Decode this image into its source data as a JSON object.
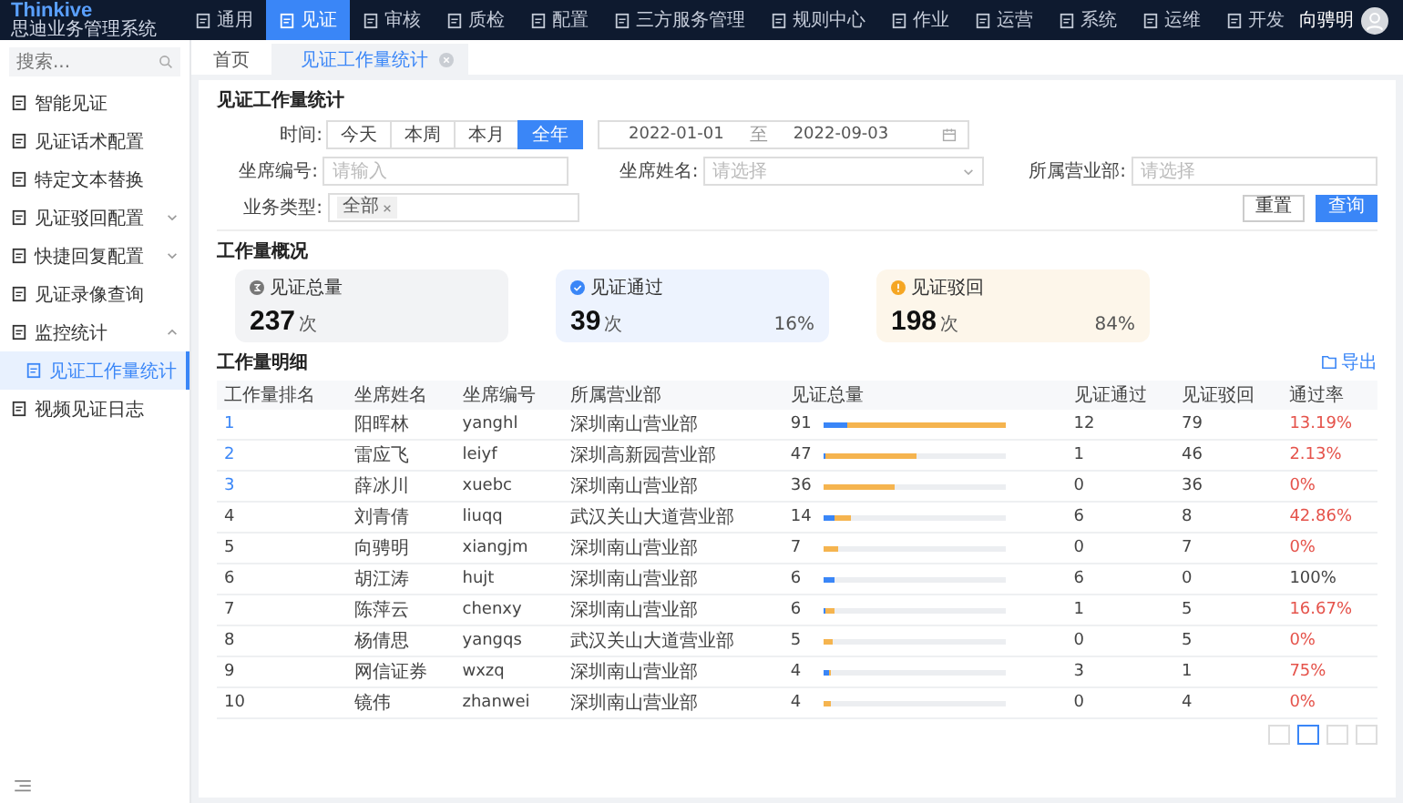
{
  "logo": {
    "name": "Thinkive",
    "subtitle": "思迪业务管理系统"
  },
  "nav": [
    {
      "label": "通用",
      "selected": false
    },
    {
      "label": "见证",
      "selected": true
    },
    {
      "label": "审核",
      "selected": false
    },
    {
      "label": "质检",
      "selected": false
    },
    {
      "label": "配置",
      "selected": false
    },
    {
      "label": "三方服务管理",
      "selected": false
    },
    {
      "label": "规则中心",
      "selected": false
    },
    {
      "label": "作业",
      "selected": false
    },
    {
      "label": "运营",
      "selected": false
    },
    {
      "label": "系统",
      "selected": false
    },
    {
      "label": "运维",
      "selected": false
    },
    {
      "label": "开发",
      "selected": false
    }
  ],
  "user": {
    "name": "向骋明"
  },
  "sidebar": {
    "search_placeholder": "搜索...",
    "items": [
      {
        "label": "智能见证",
        "selected": false
      },
      {
        "label": "见证话术配置",
        "selected": false
      },
      {
        "label": "特定文本替换",
        "selected": false
      },
      {
        "label": "见证驳回配置",
        "selected": false,
        "expanded": false
      },
      {
        "label": "快捷回复配置",
        "selected": false,
        "expanded": false
      },
      {
        "label": "见证录像查询",
        "selected": false
      },
      {
        "label": "监控统计",
        "selected": false,
        "expanded": true,
        "children": [
          {
            "label": "见证工作量统计",
            "selected": true
          }
        ]
      },
      {
        "label": "视频见证日志",
        "selected": false
      }
    ]
  },
  "tabs": [
    {
      "label": "首页",
      "selected": false,
      "closable": false
    },
    {
      "label": "见证工作量统计",
      "selected": true,
      "closable": true
    }
  ],
  "page_title": "见证工作量统计",
  "filters": {
    "time_label": "时间:",
    "periods": [
      {
        "label": "今天",
        "selected": false
      },
      {
        "label": "本周",
        "selected": false
      },
      {
        "label": "本月",
        "selected": false
      },
      {
        "label": "全年",
        "selected": true
      }
    ],
    "date_from": "2022-01-01",
    "date_sep": "至",
    "date_to": "2022-09-03",
    "seat_code": {
      "label": "坐席编号:",
      "placeholder": "请输入"
    },
    "seat_name": {
      "label": "坐席姓名:",
      "placeholder": "请选择"
    },
    "branch": {
      "label": "所属营业部:",
      "placeholder": "请选择"
    },
    "business": {
      "label": "业务类型:",
      "tags": [
        "全部"
      ]
    },
    "reset": "重置",
    "query": "查询"
  },
  "overview": {
    "title": "工作量概况",
    "cards": [
      {
        "kind": "total",
        "label": "见证总量",
        "value": "237",
        "unit": "次"
      },
      {
        "kind": "pass",
        "label": "见证通过",
        "value": "39",
        "unit": "次",
        "percent": "16%"
      },
      {
        "kind": "reject",
        "label": "见证驳回",
        "value": "198",
        "unit": "次",
        "percent": "84%"
      }
    ]
  },
  "detail": {
    "title": "工作量明细",
    "export": "导出",
    "columns": [
      "工作量排名",
      "坐席姓名",
      "坐席编号",
      "所属营业部",
      "见证总量",
      "见证通过",
      "见证驳回",
      "通过率"
    ],
    "rows": [
      {
        "rank": "1",
        "top": true,
        "name": "阳晖林",
        "code": "yanghl",
        "dept": "深圳南山营业部",
        "total": "91",
        "pass": "12",
        "reject": "79",
        "rate": "13.19%",
        "low": true,
        "pass_bar": {
          "level": 0.132
        },
        "reject_bar": {
          "level": 0.868
        }
      },
      {
        "rank": "2",
        "top": true,
        "name": "雷应飞",
        "code": "leiyf",
        "dept": "深圳高新园营业部",
        "total": "47",
        "pass": "1",
        "reject": "46",
        "rate": "2.13%",
        "low": true,
        "pass_bar": {
          "level": 0.011
        },
        "reject_bar": {
          "level": 0.505
        }
      },
      {
        "rank": "3",
        "top": true,
        "name": "薛冰川",
        "code": "xuebc",
        "dept": "深圳南山营业部",
        "total": "36",
        "pass": "0",
        "reject": "36",
        "rate": "0%",
        "low": true,
        "reject_bar": {
          "level": 0.396
        }
      },
      {
        "rank": "4",
        "top": false,
        "name": "刘青倩",
        "code": "liuqq",
        "dept": "武汉关山大道营业部",
        "total": "14",
        "pass": "6",
        "reject": "8",
        "rate": "42.86%",
        "low": true,
        "pass_bar": {
          "level": 0.066
        },
        "reject_bar": {
          "level": 0.088
        }
      },
      {
        "rank": "5",
        "top": false,
        "name": "向骋明",
        "code": "xiangjm",
        "dept": "深圳南山营业部",
        "total": "7",
        "pass": "0",
        "reject": "7",
        "rate": "0%",
        "low": true,
        "reject_bar": {
          "level": 0.077
        }
      },
      {
        "rank": "6",
        "top": false,
        "name": "胡江涛",
        "code": "hujt",
        "dept": "深圳南山营业部",
        "total": "6",
        "pass": "6",
        "reject": "0",
        "rate": "100%",
        "low": false,
        "pass_bar": {
          "level": 0.066
        }
      },
      {
        "rank": "7",
        "top": false,
        "name": "陈萍云",
        "code": "chenxy",
        "dept": "深圳南山营业部",
        "total": "6",
        "pass": "1",
        "reject": "5",
        "rate": "16.67%",
        "low": true,
        "pass_bar": {
          "level": 0.011
        },
        "reject_bar": {
          "level": 0.055
        }
      },
      {
        "rank": "8",
        "top": false,
        "name": "杨倩思",
        "code": "yangqs",
        "dept": "武汉关山大道营业部",
        "total": "5",
        "pass": "0",
        "reject": "5",
        "rate": "0%",
        "low": true,
        "reject_bar": {
          "level": 0.055
        }
      },
      {
        "rank": "9",
        "top": false,
        "name": "网信证券",
        "code": "wxzq",
        "dept": "深圳南山营业部",
        "total": "4",
        "pass": "3",
        "reject": "1",
        "rate": "75%",
        "low": true,
        "pass_bar": {
          "level": 0.033
        },
        "reject_bar": {
          "level": 0.011
        }
      },
      {
        "rank": "10",
        "top": false,
        "name": "镜伟",
        "code": "zhanwei",
        "dept": "深圳南山营业部",
        "total": "4",
        "pass": "0",
        "reject": "4",
        "rate": "0%",
        "low": true,
        "reject_bar": {
          "level": 0.044
        }
      }
    ]
  },
  "pagination": [
    {
      "selected": false
    },
    {
      "selected": true
    },
    {
      "selected": false
    },
    {
      "selected": false
    }
  ]
}
